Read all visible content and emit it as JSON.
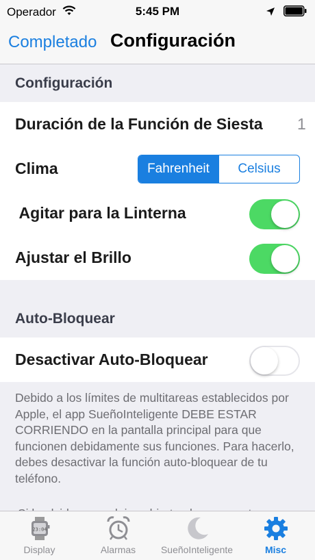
{
  "status": {
    "carrier": "Operador",
    "time": "5:45 PM"
  },
  "nav": {
    "done_label": "Completado",
    "title": "Configuración"
  },
  "settings": {
    "header": "Configuración",
    "nap_label": "Duración de la Función de Siesta",
    "nap_value": "1",
    "climate_label": "Clima",
    "climate_options": [
      "Fahrenheit",
      "Celsius"
    ],
    "climate_selected": "Fahrenheit",
    "flashlight_label": " Agitar para la Linterna",
    "flashlight_on": true,
    "brightness_label": "Ajustar el Brillo",
    "brightness_on": true
  },
  "autolock": {
    "header": "Auto-Bloquear",
    "disable_label": "Desactivar Auto-Bloquear",
    "disable_on": false,
    "footer_1": "Debido a los límites de multitareas establecidos por Apple, el app SueñoInteligente DEBE ESTAR CORRIENDO en la pantalla principal para que funcionen debidamente sus funciones. Para hacerlo, debes desactivar la función auto-bloquear de tu teléfono.",
    "footer_2": "Si lo olvidas y no dejas abierto el app, nosotros"
  },
  "tabs": [
    {
      "label": "Display",
      "icon": "watch-icon"
    },
    {
      "label": "Alarmas",
      "icon": "alarm-clock-icon"
    },
    {
      "label": "SueñoInteligente",
      "icon": "moon-icon"
    },
    {
      "label": "Misc",
      "icon": "gear-icon"
    }
  ],
  "active_tab": "Misc",
  "colors": {
    "accent": "#1a7fe0",
    "toggle_on": "#4cd964",
    "background": "#efeff4"
  }
}
